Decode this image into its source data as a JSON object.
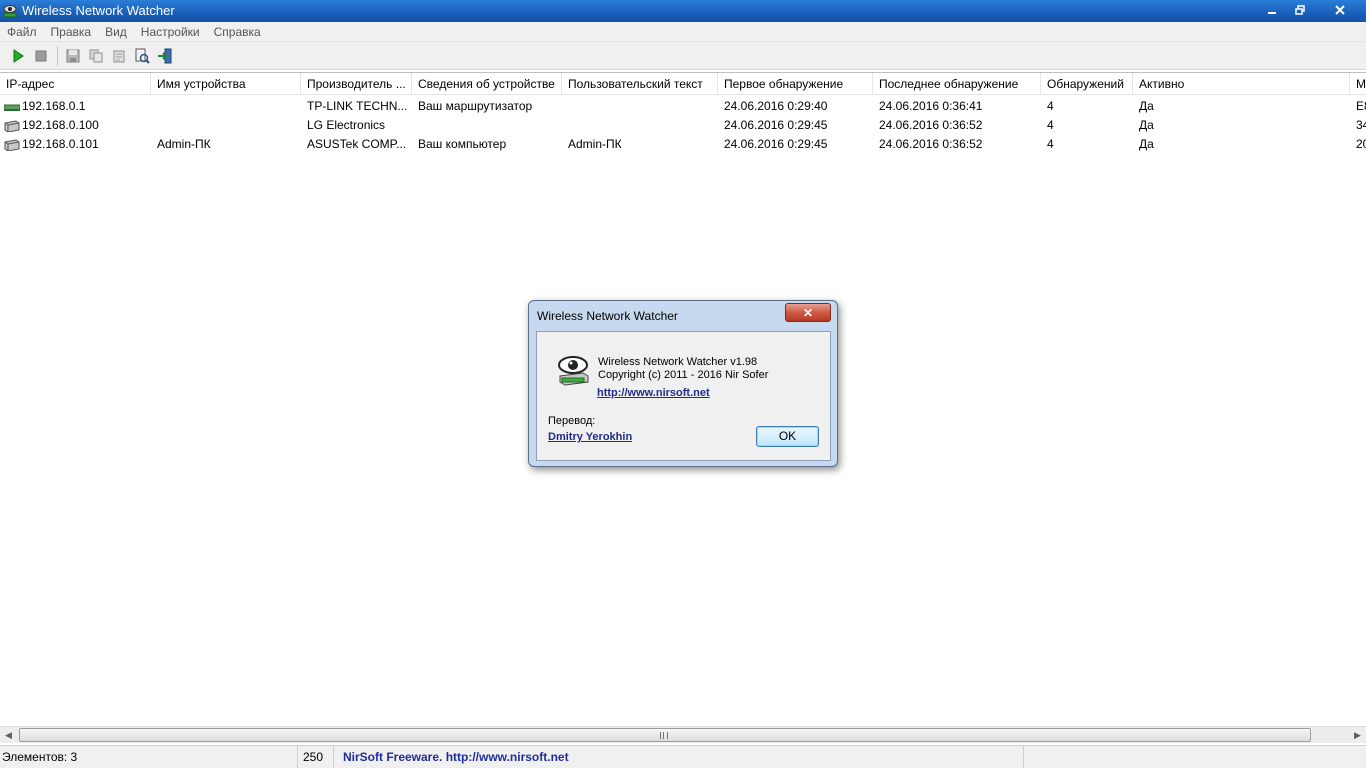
{
  "window": {
    "title": "Wireless Network Watcher"
  },
  "menu": [
    "Файл",
    "Правка",
    "Вид",
    "Настройки",
    "Справка"
  ],
  "toolbar": {
    "buttons": [
      "start-scan",
      "stop-scan",
      "save",
      "copy",
      "html-report",
      "properties",
      "exit"
    ]
  },
  "table": {
    "columns": [
      "IP-адрес",
      "Имя устройства",
      "Производитель ...",
      "Сведения об устройстве",
      "Пользовательский текст",
      "Первое обнаружение",
      "Последнее обнаружение",
      "Обнаружений",
      "Активно",
      "M"
    ],
    "rows": [
      {
        "ip": "192.168.0.1",
        "name": "",
        "vendor": "TP-LINK TECHN...",
        "info": "Ваш маршрутизатор",
        "user_text": "",
        "first": "24.06.2016 0:29:40",
        "last": "24.06.2016 0:36:41",
        "count": "4",
        "active": "Да",
        "mac": "E8",
        "icon": "router-icon"
      },
      {
        "ip": "192.168.0.100",
        "name": "",
        "vendor": "LG Electronics",
        "info": "",
        "user_text": "",
        "first": "24.06.2016 0:29:45",
        "last": "24.06.2016 0:36:52",
        "count": "4",
        "active": "Да",
        "mac": "34",
        "icon": "computer-icon"
      },
      {
        "ip": "192.168.0.101",
        "name": "Admin-ПК",
        "vendor": "ASUSTek COMP...",
        "info": "Ваш компьютер",
        "user_text": "Admin-ПК",
        "first": "24.06.2016 0:29:45",
        "last": "24.06.2016 0:36:52",
        "count": "4",
        "active": "Да",
        "mac": "20",
        "icon": "computer-icon"
      }
    ]
  },
  "status": {
    "items": "Элементов: 3",
    "count": "250",
    "freeware": "NirSoft Freeware.  http://www.nirsoft.net"
  },
  "about": {
    "title": "Wireless Network Watcher",
    "version": "Wireless Network Watcher v1.98",
    "copyright": "Copyright (c) 2011 - 2016 Nir Sofer",
    "url": "http://www.nirsoft.net",
    "translation_label": "Перевод:",
    "translator": "Dmitry Yerokhin",
    "ok": "OK",
    "close": "✕"
  },
  "colors": {
    "titlebar": "#1a5fb8",
    "link": "#1f2e9e",
    "close_button": "#cf5b45"
  }
}
